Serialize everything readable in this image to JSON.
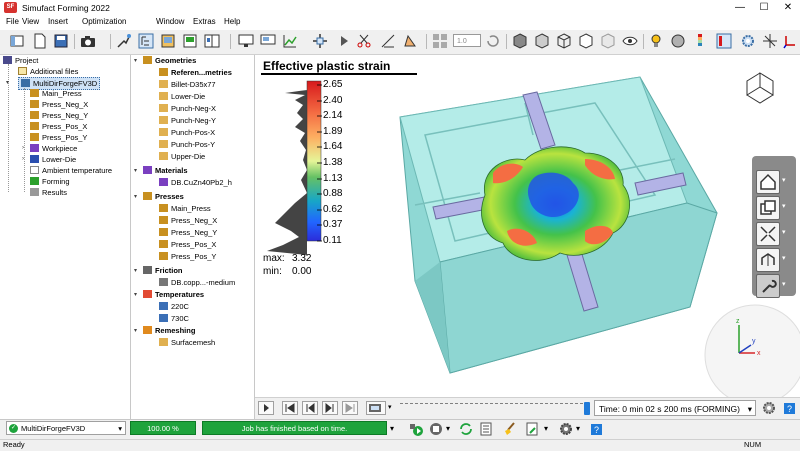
{
  "window": {
    "title": "Simufact Forming 2022",
    "logo_text": "SF",
    "minimize": "—",
    "maximize": "☐",
    "close": "✕"
  },
  "menu": [
    "File",
    "View",
    "Insert",
    "Optimization",
    "Window",
    "Extras",
    "Help"
  ],
  "toolbar": {
    "zoom_value": "1.0"
  },
  "project_tree": {
    "root": "Project",
    "additional_files": "Additional files",
    "simulation": "MultiDirForgeFV3D",
    "items": [
      "Main_Press",
      "Press_Neg_X",
      "Press_Neg_Y",
      "Press_Pos_X",
      "Press_Pos_Y",
      "Workpiece",
      "Lower-Die",
      "Ambient temperature",
      "Forming",
      "Results"
    ]
  },
  "details": {
    "geometries": {
      "label": "Geometries",
      "items": [
        "Referen...metries",
        "Billet-D35x77",
        "Lower-Die",
        "Punch-Neg-X",
        "Punch-Neg-Y",
        "Punch-Pos-X",
        "Punch-Pos-Y",
        "Upper-Die"
      ]
    },
    "materials": {
      "label": "Materials",
      "items": [
        "DB.CuZn40Pb2_h"
      ]
    },
    "presses": {
      "label": "Presses",
      "items": [
        "Main_Press",
        "Press_Neg_X",
        "Press_Neg_Y",
        "Press_Pos_X",
        "Press_Pos_Y"
      ]
    },
    "friction": {
      "label": "Friction",
      "items": [
        "DB.copp...-medium"
      ]
    },
    "temperatures": {
      "label": "Temperatures",
      "items": [
        "220C",
        "730C"
      ]
    },
    "remeshing": {
      "label": "Remeshing",
      "items": [
        "Surfacemesh"
      ]
    }
  },
  "legend": {
    "title": "Effective plastic strain",
    "values": [
      "2.65",
      "2.40",
      "2.14",
      "1.89",
      "1.64",
      "1.38",
      "1.13",
      "0.88",
      "0.62",
      "0.37",
      "0.11"
    ],
    "max_label": "max:",
    "max_value": "3.32",
    "min_label": "min:",
    "min_value": "0.00"
  },
  "playback": {
    "time": "Time: 0 min 02 s 200 ms (FORMING)",
    "position_fraction": 0.98
  },
  "status": {
    "simulation": "MultiDirForgeFV3D",
    "progress_text": "100.00 %",
    "progress": 1.0,
    "job_status": "Job has finished based on time.",
    "ready": "Ready",
    "num": "NUM"
  },
  "colors": {
    "die": "#a8e8e4",
    "pin": "#b3b3e6",
    "progress": "#1ea33c",
    "accent": "#1f7ad9"
  }
}
